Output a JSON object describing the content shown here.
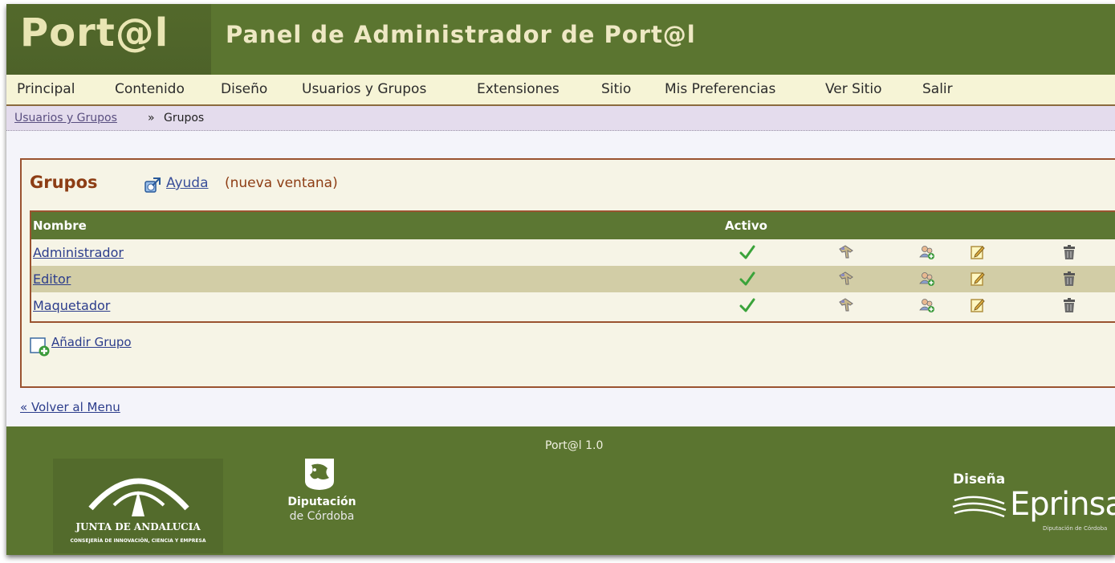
{
  "header": {
    "logo_text": "Port@l",
    "panel_title": "Panel de Administrador de Port@l",
    "brand_color": "#5b7530"
  },
  "nav": {
    "items": [
      "Principal",
      "Contenido",
      "Diseño",
      "Usuarios y Grupos",
      "Extensiones",
      "Sitio",
      "Mis Preferencias",
      "Ver Sitio",
      "Salir"
    ]
  },
  "breadcrumb": {
    "parent": "Usuarios y Grupos",
    "separator": "»",
    "current": "Grupos"
  },
  "content": {
    "title": "Grupos",
    "help_link": "Ayuda",
    "help_note": "(nueva ventana)",
    "table": {
      "headers": {
        "name": "Nombre",
        "active": "Activo"
      },
      "rows": [
        {
          "name": "Administrador",
          "active": true
        },
        {
          "name": "Editor",
          "active": true
        },
        {
          "name": "Maquetador",
          "active": true
        }
      ],
      "row_icons": [
        "check-icon",
        "permissions-icon",
        "group-users-icon",
        "edit-icon",
        "trash-icon"
      ]
    },
    "add_group": "Añadir Grupo",
    "back_link": "« Volver al Menu"
  },
  "footer": {
    "version": "Port@l 1.0",
    "junta": {
      "name": "JUNTA DE ANDALUCIA",
      "subtitle": "CONSEJERÍA DE INNOVACIÓN, CIENCIA Y EMPRESA"
    },
    "diputacion": {
      "name": "Diputación",
      "subtitle": "de Córdoba"
    },
    "designer": {
      "label": "Diseña",
      "name": "Eprinsa",
      "subtitle": "Diputación de Córdoba"
    }
  }
}
